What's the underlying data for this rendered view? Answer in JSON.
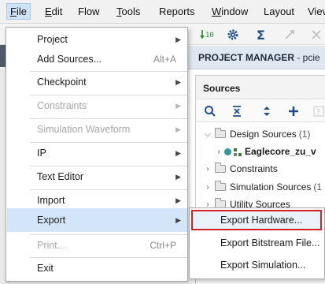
{
  "menubar": {
    "items": [
      {
        "label": "File",
        "mnemonic": "F",
        "rest": "ile"
      },
      {
        "label": "Edit",
        "mnemonic": "E",
        "rest": "dit"
      },
      {
        "label": "Flow",
        "mnemonic": "",
        "rest": "Flow"
      },
      {
        "label": "Tools",
        "mnemonic": "T",
        "rest": "ools"
      },
      {
        "label": "Reports",
        "mnemonic": "",
        "rest": "Reports"
      },
      {
        "label": "Window",
        "mnemonic": "W",
        "rest": "indow"
      },
      {
        "label": "Layout",
        "mnemonic": "",
        "rest": "Layout"
      },
      {
        "label": "View",
        "mnemonic": "",
        "rest": "Viev"
      }
    ]
  },
  "project_manager": {
    "title": "PROJECT MANAGER",
    "suffix": " - pcie"
  },
  "sources": {
    "title": "Sources",
    "tree": [
      {
        "label": "Design Sources",
        "count": "(1)"
      },
      {
        "label": "Eaglecore_zu_v",
        "count": ""
      },
      {
        "label": "Constraints",
        "count": ""
      },
      {
        "label": "Simulation Sources",
        "count": "(1"
      },
      {
        "label": "Utility Sources",
        "count": ""
      }
    ]
  },
  "file_menu": {
    "items": [
      {
        "label": "Project",
        "shortcut": "",
        "submenu": true,
        "disabled": false
      },
      {
        "label": "Add Sources...",
        "shortcut": "Alt+A",
        "submenu": false,
        "disabled": false
      },
      {
        "label": "Checkpoint",
        "shortcut": "",
        "submenu": true,
        "disabled": false
      },
      {
        "label": "Constraints",
        "shortcut": "",
        "submenu": true,
        "disabled": true
      },
      {
        "label": "Simulation Waveform",
        "shortcut": "",
        "submenu": true,
        "disabled": true
      },
      {
        "label": "IP",
        "shortcut": "",
        "submenu": true,
        "disabled": false
      },
      {
        "label": "Text Editor",
        "shortcut": "",
        "submenu": true,
        "disabled": false
      },
      {
        "label": "Import",
        "shortcut": "",
        "submenu": true,
        "disabled": false
      },
      {
        "label": "Export",
        "shortcut": "",
        "submenu": true,
        "disabled": false,
        "hover": true
      },
      {
        "label": "Print...",
        "shortcut": "Ctrl+P",
        "submenu": false,
        "disabled": true
      },
      {
        "label": "Exit",
        "shortcut": "",
        "submenu": false,
        "disabled": false
      }
    ]
  },
  "export_submenu": {
    "items": [
      {
        "label": "Export Hardware...",
        "highlighted": true
      },
      {
        "label": "Export Bitstream File...",
        "highlighted": false
      },
      {
        "label": "Export Simulation...",
        "highlighted": false
      }
    ]
  },
  "colors": {
    "highlight_border": "#d61f26",
    "hover_bg": "#d3e5f8",
    "accent_blue": "#1f6fb5"
  }
}
